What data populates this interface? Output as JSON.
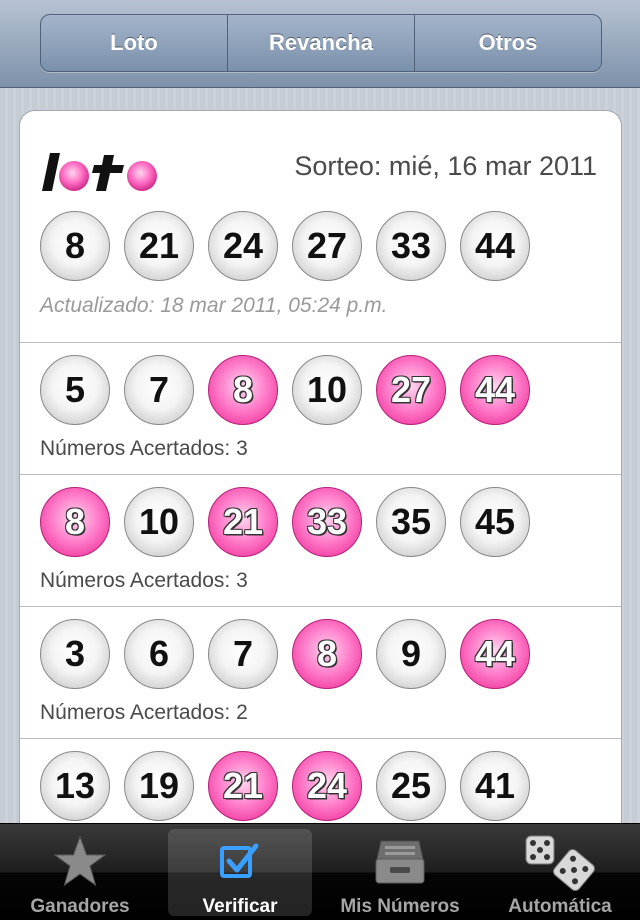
{
  "segments": [
    "Loto",
    "Revancha",
    "Otros"
  ],
  "draw": {
    "title": "Sorteo: mié, 16 mar 2011",
    "numbers": [
      "8",
      "21",
      "24",
      "27",
      "33",
      "44"
    ],
    "updated": "Actualizado: 18 mar 2011, 05:24 p.m."
  },
  "tickets": [
    {
      "balls": [
        {
          "n": "5",
          "hit": false
        },
        {
          "n": "7",
          "hit": false
        },
        {
          "n": "8",
          "hit": true
        },
        {
          "n": "10",
          "hit": false
        },
        {
          "n": "27",
          "hit": true
        },
        {
          "n": "44",
          "hit": true
        }
      ],
      "hits_text": "Números Acertados: 3"
    },
    {
      "balls": [
        {
          "n": "8",
          "hit": true
        },
        {
          "n": "10",
          "hit": false
        },
        {
          "n": "21",
          "hit": true
        },
        {
          "n": "33",
          "hit": true
        },
        {
          "n": "35",
          "hit": false
        },
        {
          "n": "45",
          "hit": false
        }
      ],
      "hits_text": "Números Acertados: 3"
    },
    {
      "balls": [
        {
          "n": "3",
          "hit": false
        },
        {
          "n": "6",
          "hit": false
        },
        {
          "n": "7",
          "hit": false
        },
        {
          "n": "8",
          "hit": true
        },
        {
          "n": "9",
          "hit": false
        },
        {
          "n": "44",
          "hit": true
        }
      ],
      "hits_text": "Números Acertados: 2"
    },
    {
      "balls": [
        {
          "n": "13",
          "hit": false
        },
        {
          "n": "19",
          "hit": false
        },
        {
          "n": "21",
          "hit": true
        },
        {
          "n": "24",
          "hit": true
        },
        {
          "n": "25",
          "hit": false
        },
        {
          "n": "41",
          "hit": false
        }
      ],
      "hits_text": ""
    }
  ],
  "tabs": [
    {
      "label": "Ganadores",
      "icon": "star-icon",
      "active": false
    },
    {
      "label": "Verificar",
      "icon": "checkbox-icon",
      "active": true
    },
    {
      "label": "Mis Números",
      "icon": "inbox-tray-icon",
      "active": false
    },
    {
      "label": "Automática",
      "icon": "dice-icon",
      "active": false
    }
  ],
  "colors": {
    "hit_ball": "#f44aa9",
    "nav_bar": "#7d91aa",
    "tab_bar": "#000000"
  }
}
